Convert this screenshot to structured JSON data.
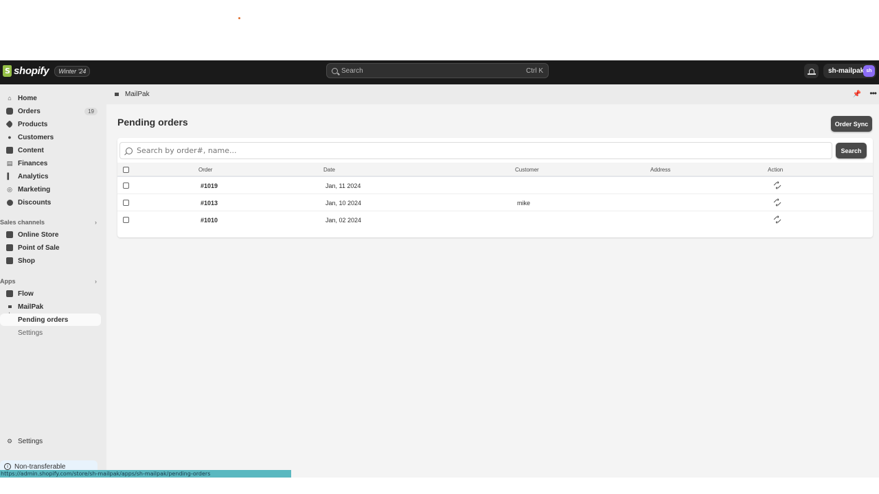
{
  "topbar": {
    "brand": "shopify",
    "edition_badge": "Winter '24",
    "search_placeholder": "Search",
    "search_shortcut": "Ctrl K",
    "store_name": "sh-mailpak",
    "avatar_initials": "sh"
  },
  "sidebar": {
    "main_items": [
      {
        "label": "Home",
        "icon": "home-icon"
      },
      {
        "label": "Orders",
        "icon": "orders-icon",
        "count": "19"
      },
      {
        "label": "Products",
        "icon": "tag-icon"
      },
      {
        "label": "Customers",
        "icon": "person-icon"
      },
      {
        "label": "Content",
        "icon": "content-icon"
      },
      {
        "label": "Finances",
        "icon": "bank-icon"
      },
      {
        "label": "Analytics",
        "icon": "bar-chart-icon"
      },
      {
        "label": "Marketing",
        "icon": "target-icon"
      },
      {
        "label": "Discounts",
        "icon": "discount-icon"
      }
    ],
    "sales_channels_label": "Sales channels",
    "sales_channels": [
      {
        "label": "Online Store",
        "icon": "store-icon"
      },
      {
        "label": "Point of Sale",
        "icon": "pos-icon"
      },
      {
        "label": "Shop",
        "icon": "shop-icon"
      }
    ],
    "apps_label": "Apps",
    "apps": [
      {
        "label": "Flow",
        "icon": "flow-icon"
      },
      {
        "label": "MailPak",
        "icon": "mailpak-icon"
      }
    ],
    "app_subitems": [
      {
        "label": "Pending orders",
        "active": true
      },
      {
        "label": "Settings",
        "active": false
      }
    ],
    "settings_label": "Settings",
    "notice_label": "Non-transferable"
  },
  "app_bar": {
    "app_name": "MailPak"
  },
  "page": {
    "title": "Pending orders",
    "order_sync_label": "Order Sync",
    "search_placeholder": "Search by order#, name...",
    "search_value": "",
    "search_button_label": "Search"
  },
  "table": {
    "columns": [
      "Order",
      "Date",
      "Customer",
      "Address",
      "Action"
    ],
    "rows": [
      {
        "order": "#1019",
        "date": "Jan, 11 2024",
        "customer": "",
        "address": "",
        "action_icon": "sync-icon"
      },
      {
        "order": "#1013",
        "date": "Jan, 10 2024",
        "customer": "mike",
        "address": "",
        "action_icon": "sync-icon"
      },
      {
        "order": "#1010",
        "date": "Jan, 02 2024",
        "customer": "",
        "address": "",
        "action_icon": "sync-icon"
      }
    ]
  },
  "status_bar": {
    "url": "https://admin.shopify.com/store/sh-mailpak/apps/sh-mailpak/pending-orders"
  },
  "colors": {
    "topbar_bg": "#1a1a1a",
    "sidebar_bg": "#ebebeb",
    "content_bg": "#f4f4f4",
    "button_dark": "#4a4a4a",
    "avatar": "#8b6cf5",
    "status_bar": "#5ab8c0"
  }
}
